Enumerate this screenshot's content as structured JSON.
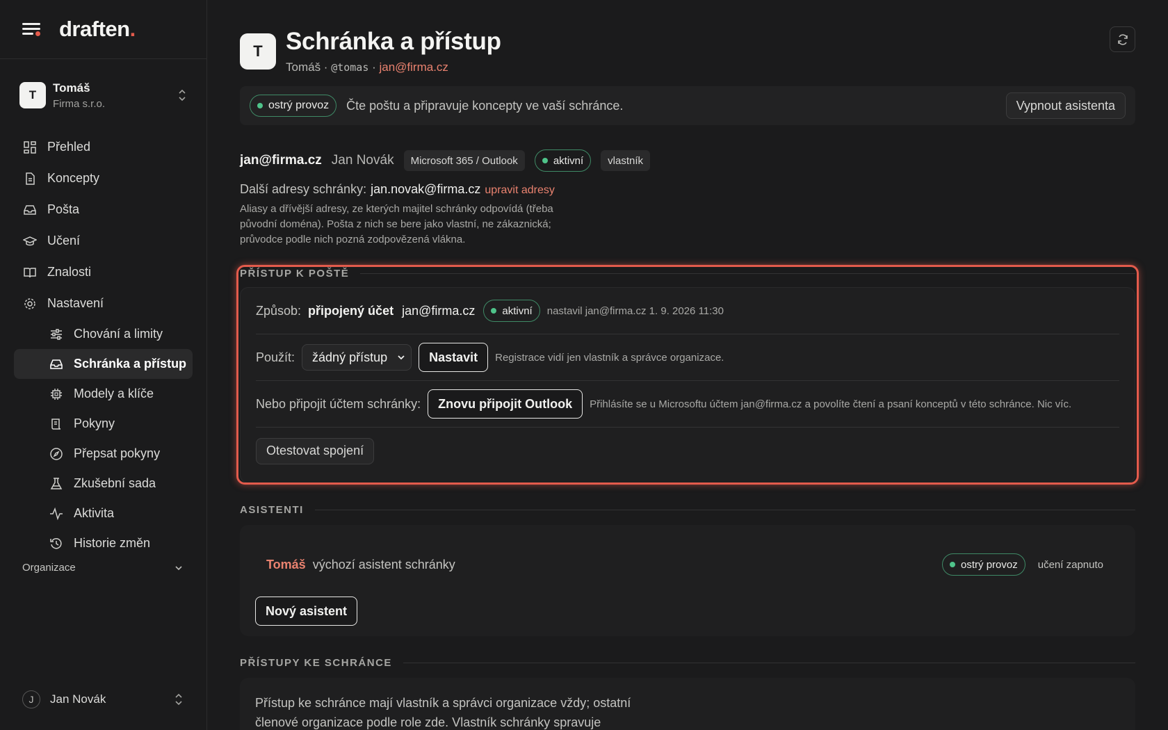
{
  "brand": {
    "name": "draften",
    "dot": "."
  },
  "workspace": {
    "avatar": "T",
    "name": "Tomáš",
    "org": "Firma s.r.o."
  },
  "nav": {
    "prehled": "Přehled",
    "koncepty": "Koncepty",
    "posta": "Pošta",
    "uceni": "Učení",
    "znalosti": "Znalosti",
    "nastaveni": "Nastavení",
    "sub": {
      "chovani": "Chování a limity",
      "schranka": "Schránka a přístup",
      "modely": "Modely a klíče",
      "pokyny": "Pokyny",
      "prepsat": "Přepsat pokyny",
      "zkusebni": "Zkušební sada",
      "aktivita": "Aktivita",
      "historie": "Historie změn"
    },
    "organizace": "Organizace"
  },
  "user": {
    "avatar": "J",
    "name": "Jan Novák"
  },
  "header": {
    "avatar": "T",
    "title": "Schránka a přístup",
    "sub_name": "Tomáš",
    "sep1": " · ",
    "handle": "@tomas",
    "sep2": " · ",
    "email": "jan@firma.cz"
  },
  "status": {
    "pill": "ostrý provoz",
    "text": "Čte poštu a připravuje koncepty ve vaší schránce.",
    "button": "Vypnout asistenta"
  },
  "account": {
    "email": "jan@firma.cz",
    "name": "Jan Novák",
    "provider": "Microsoft 365 / Outlook",
    "state": "aktivní",
    "role": "vlastník"
  },
  "addresses": {
    "label": "Další adresy schránky:",
    "value": "jan.novak@firma.cz",
    "link": "upravit adresy",
    "help": "Aliasy a dřívější adresy, ze kterých majitel schránky odpovídá (třeba původní doména). Pošta z nich se bere jako vlastní, ne zákaznická; průvodce podle nich pozná zodpovězená vlákna."
  },
  "access": {
    "section_title": "PŘÍSTUP K POŠTĚ",
    "method_label": "Způsob:",
    "method_value": "připojený účet",
    "method_email": "jan@firma.cz",
    "method_state": "aktivní",
    "method_meta": "nastavil jan@firma.cz 1. 9. 2026 11:30",
    "use_label": "Použít:",
    "use_select": "žádný přístup",
    "use_button": "Nastavit",
    "use_meta": "Registrace vidí jen vlastník a správce organizace.",
    "connect_label": "Nebo připojit účtem schránky:",
    "connect_button": "Znovu připojit Outlook",
    "connect_meta": "Přihlásíte se u Microsoftu účtem jan@firma.cz a povolíte čtení a psaní konceptů v této schránce. Nic víc.",
    "test_button": "Otestovat spojení"
  },
  "assistants": {
    "section_title": "ASISTENTI",
    "name": "Tomáš",
    "desc": "výchozí asistent schránky",
    "state": "ostrý provoz",
    "learning": "učení zapnuto",
    "new_button": "Nový asistent"
  },
  "permissions": {
    "section_title": "PŘÍSTUPY KE SCHRÁNCE",
    "text": "Přístup ke schránce mají vlastník a správci organizace vždy; ostatní členové organizace podle role zde. Vlastník schránky spravuje"
  },
  "colors": {
    "accent": "#e35b4c",
    "link": "#e9826f",
    "active": "#4fc38a"
  }
}
